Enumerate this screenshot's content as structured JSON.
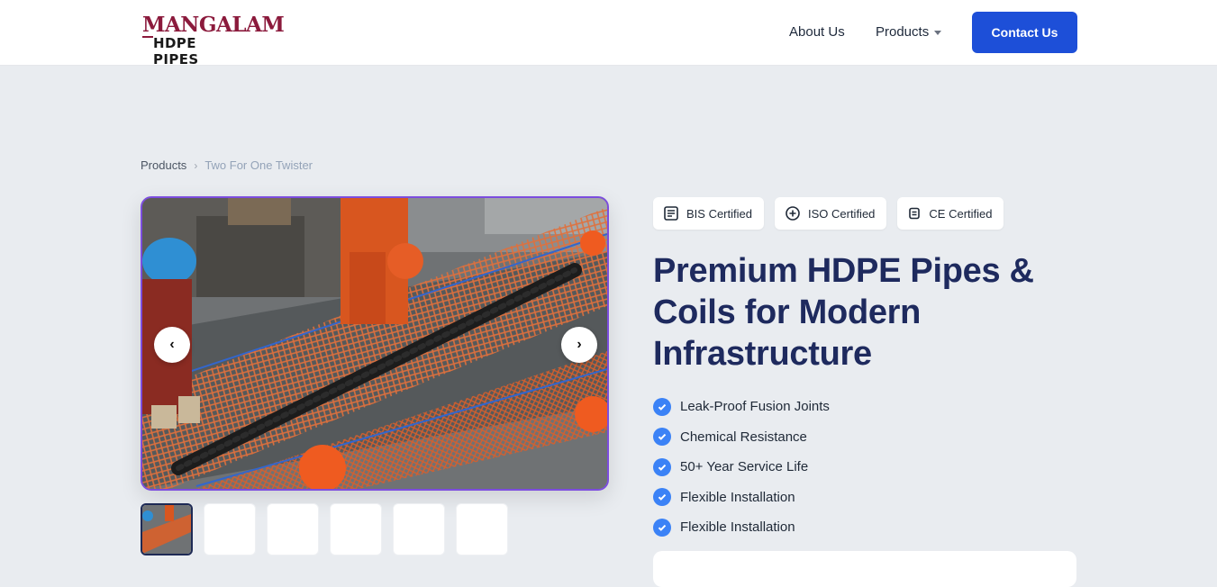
{
  "header": {
    "logo_top": "MANGALAM",
    "logo_bottom": "HDPE PIPES",
    "nav_about": "About Us",
    "nav_products": "Products",
    "contact_button": "Contact Us"
  },
  "breadcrumb": {
    "parent": "Products",
    "separator": "›",
    "current": "Two For One Twister"
  },
  "gallery": {
    "prev_icon": "chevron-left-icon",
    "next_icon": "chevron-right-icon",
    "prev_glyph": "‹",
    "next_glyph": "›",
    "thumbnail_count": 6,
    "active_thumbnail": 1
  },
  "badges": [
    {
      "label": "BIS Certified",
      "icon": "document-icon"
    },
    {
      "label": "ISO Certified",
      "icon": "plus-circle-icon"
    },
    {
      "label": "CE Certified",
      "icon": "document-small-icon"
    }
  ],
  "product": {
    "title": "Premium HDPE Pipes & Coils for Modern Infrastructure",
    "features": [
      "Leak-Proof Fusion Joints",
      "Chemical Resistance",
      "50+ Year Service Life",
      "Flexible Installation",
      "Flexible Installation"
    ]
  },
  "colors": {
    "primary": "#1d4fd8",
    "title": "#1e2a5e",
    "brand": "#8b1a3c",
    "check": "#3b82f6",
    "gallery_border": "#7c4dde",
    "background": "#e9ecf0"
  }
}
